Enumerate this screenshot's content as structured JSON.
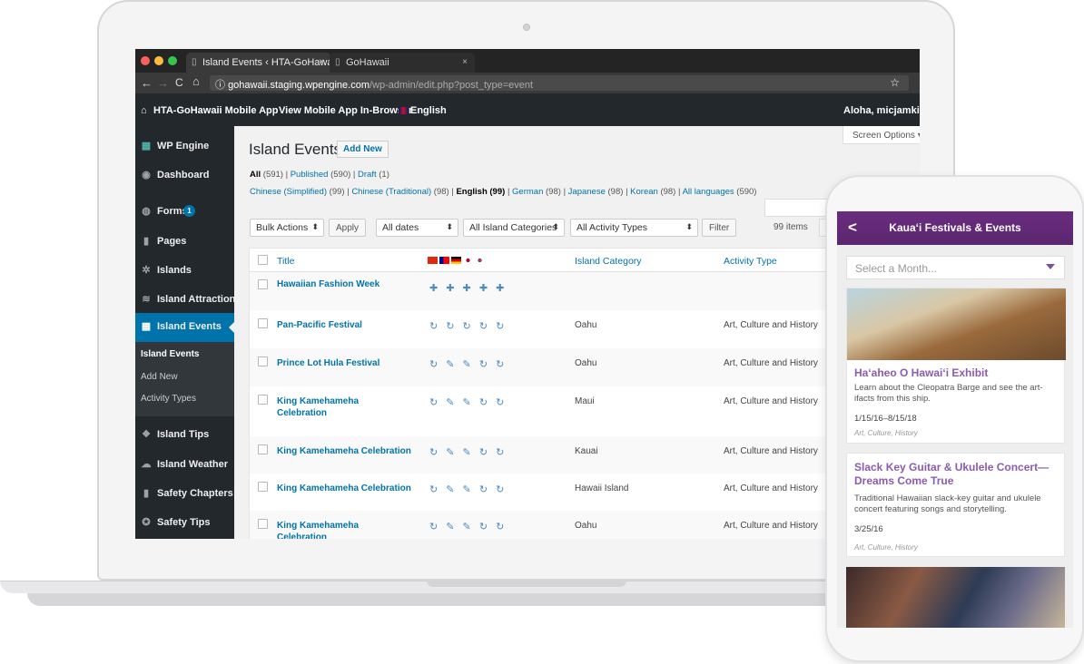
{
  "browser": {
    "tabs": [
      {
        "label": "Island Events ‹ HTA-GoHawai",
        "close": "×"
      },
      {
        "label": "GoHawaii",
        "close": "×"
      }
    ],
    "url_host": "gohawaii.staging.wpengine.com",
    "url_path": "/wp-admin/edit.php?post_type=event",
    "back": "←",
    "forward": "→",
    "reload": "C",
    "home": "⌂",
    "info": "ⓘ",
    "star": "☆"
  },
  "adminbar": {
    "site": "HTA-GoHawaii Mobile App",
    "view": "View Mobile App In-Browser",
    "language": "English",
    "greeting": "Aloha, micjamking"
  },
  "sidebar": {
    "items": [
      {
        "label": "WP Engine",
        "icon": "wpengine-icon"
      },
      {
        "label": "Dashboard",
        "icon": "dashboard-icon"
      },
      {
        "label": "Forms",
        "icon": "forms-icon",
        "badge": "1"
      },
      {
        "label": "Pages",
        "icon": "pages-icon"
      },
      {
        "label": "Islands",
        "icon": "palm-icon"
      },
      {
        "label": "Island Attractions",
        "icon": "attractions-icon"
      },
      {
        "label": "Island Events",
        "icon": "calendar-icon"
      },
      {
        "label": "Island Tips",
        "icon": "tips-icon"
      },
      {
        "label": "Island Weather",
        "icon": "cloud-icon"
      },
      {
        "label": "Safety Chapters",
        "icon": "book-icon"
      },
      {
        "label": "Safety Tips",
        "icon": "lifebuoy-icon"
      }
    ],
    "submenu": [
      "Island Events",
      "Add New",
      "Activity Types"
    ]
  },
  "main": {
    "title": "Island Events",
    "add_new": "Add New",
    "screen_options": "Screen Options",
    "status": {
      "all": "All",
      "all_count": "(591)",
      "published": "Published",
      "published_count": "(590)",
      "draft": "Draft",
      "draft_count": "(1)",
      "sep": "|"
    },
    "languages": [
      {
        "label": "Chinese (Simplified)",
        "count": "(99)"
      },
      {
        "label": "Chinese (Traditional)",
        "count": "(98)"
      },
      {
        "label": "English",
        "count": "(99)"
      },
      {
        "label": "German",
        "count": "(98)"
      },
      {
        "label": "Japanese",
        "count": "(98)"
      },
      {
        "label": "Korean",
        "count": "(98)"
      },
      {
        "label": "All languages",
        "count": "(590)"
      }
    ],
    "filters": {
      "bulk": "Bulk Actions",
      "apply": "Apply",
      "dates": "All dates",
      "categories": "All Island Categories",
      "activity": "All Activity Types",
      "filter": "Filter",
      "items": "99 items",
      "page_prev": "«"
    },
    "table": {
      "headers": {
        "title": "Title",
        "category": "Island Category",
        "activity": "Activity Type"
      },
      "rows": [
        {
          "title": "Hawaiian Fashion Week",
          "langs": "✚ ✚ ✚ ✚ ✚",
          "category": "",
          "activity": ""
        },
        {
          "title": "Pan-Pacific Festival",
          "langs": "↻ ↻ ↻ ↻ ↻",
          "category": "Oahu",
          "activity": "Art, Culture and History"
        },
        {
          "title": "Prince Lot Hula Festival",
          "langs": "↻ ✎ ✎ ↻ ↻",
          "category": "Oahu",
          "activity": "Art, Culture and History"
        },
        {
          "title": "King Kamehameha Celebration",
          "langs": "↻ ✎ ✎ ↻ ↻",
          "category": "Maui",
          "activity": "Art, Culture and History"
        },
        {
          "title": "King Kamehameha Celebration",
          "langs": "↻ ✎ ✎ ↻ ↻",
          "category": "Kauai",
          "activity": "Art, Culture and History"
        },
        {
          "title": "King Kamehameha Celebration",
          "langs": "↻ ✎ ✎ ↻ ↻",
          "category": "Hawaii Island",
          "activity": "Art, Culture and History"
        },
        {
          "title": "King Kamehameha Celebration",
          "langs": "↻ ✎ ✎ ↻ ↻",
          "category": "Oahu",
          "activity": "Art, Culture and History"
        }
      ]
    }
  },
  "phone": {
    "title": "Kaua‘i Festivals & Events",
    "back": "<",
    "select_placeholder": "Select a Month...",
    "cards": [
      {
        "title": "Ha‘aheo O Hawai‘i Exhibit",
        "desc": "Learn about the Cleopatra Barge and see the art-ifacts from this ship.",
        "date": "1/15/16–8/15/18",
        "tag": "Art, Culture, History"
      },
      {
        "title": "Slack Key Guitar & Ukulele Concert—Dreams Come True",
        "desc": "Traditional Hawaiian slack-key guitar and ukulele concert featuring songs and storytelling.",
        "date": "3/25/16",
        "tag": "Art, Culture, History"
      }
    ]
  },
  "colors": {
    "wp_blue": "#0073aa",
    "admin_dark": "#23282d",
    "phone_purple": "#6a2d7e"
  }
}
